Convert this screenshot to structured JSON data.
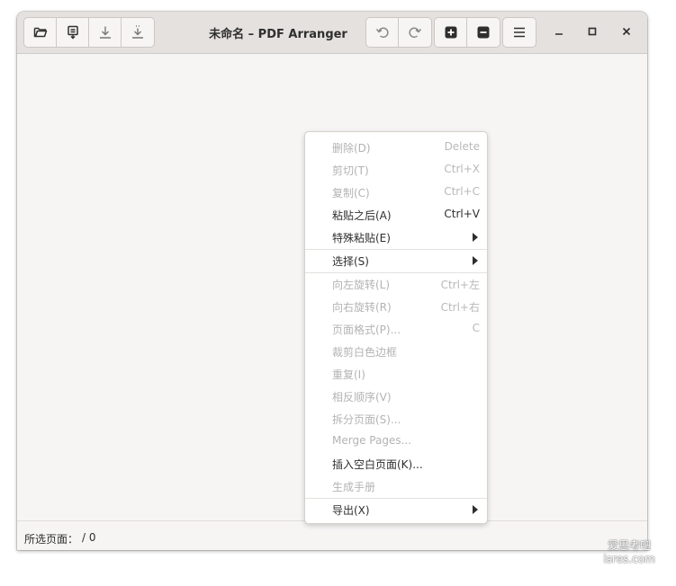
{
  "window": {
    "title": "未命名 – PDF Arranger"
  },
  "toolbar": {
    "left_buttons": [
      {
        "icon": "open-folder-icon"
      },
      {
        "icon": "import-icon"
      },
      {
        "icon": "save-icon"
      },
      {
        "icon": "save-as-icon"
      }
    ],
    "undo_icon": "undo-icon",
    "redo_icon": "redo-icon",
    "zoom_in_icon": "zoom-in-icon",
    "zoom_out_icon": "zoom-out-icon",
    "menu_icon": "hamburger-menu-icon"
  },
  "statusbar": {
    "label": "所选页面：",
    "count": "/ 0"
  },
  "context_menu": {
    "items": [
      {
        "label": "删除(D)",
        "accel": "Delete",
        "enabled": false
      },
      {
        "label": "剪切(T)",
        "accel": "Ctrl+X",
        "enabled": false
      },
      {
        "label": "复制(C)",
        "accel": "Ctrl+C",
        "enabled": false
      },
      {
        "label": "粘贴之后(A)",
        "accel": "Ctrl+V",
        "enabled": true
      },
      {
        "label": "特殊粘贴(E)",
        "accel": "",
        "enabled": true,
        "submenu": true
      },
      {
        "label": "选择(S)",
        "accel": "",
        "enabled": true,
        "submenu": true
      },
      {
        "label": "向左旋转(L)",
        "accel": "Ctrl+左",
        "enabled": false
      },
      {
        "label": "向右旋转(R)",
        "accel": "Ctrl+右",
        "enabled": false
      },
      {
        "label": "页面格式(P)...",
        "accel": "C",
        "enabled": false
      },
      {
        "label": "裁剪白色边框",
        "accel": "",
        "enabled": false
      },
      {
        "label": "重复(I)",
        "accel": "",
        "enabled": false
      },
      {
        "label": "相反顺序(V)",
        "accel": "",
        "enabled": false
      },
      {
        "label": "拆分页面(S)...",
        "accel": "",
        "enabled": false
      },
      {
        "label": "Merge Pages...",
        "accel": "",
        "enabled": false
      },
      {
        "label": "插入空白页面(K)...",
        "accel": "",
        "enabled": true
      },
      {
        "label": "生成手册",
        "accel": "",
        "enabled": false
      },
      {
        "label": "导出(X)",
        "accel": "",
        "enabled": true,
        "submenu": true
      }
    ]
  },
  "watermark": {
    "line1": "爱思考吧",
    "line2": "isres.com"
  }
}
